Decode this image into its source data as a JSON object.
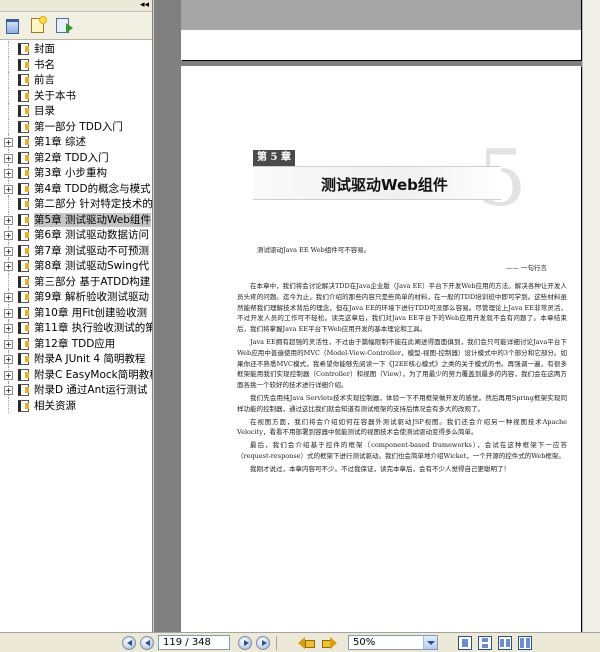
{
  "sidebar": {
    "collapse_glyph": "◂◂",
    "toolbar": [
      {
        "name": "trash-icon"
      },
      {
        "name": "new-bookmark-icon"
      },
      {
        "name": "bookmark-prop-icon"
      }
    ],
    "bookmarks": [
      {
        "label": "封面",
        "expander": "",
        "current": false
      },
      {
        "label": "书名",
        "expander": "",
        "current": false
      },
      {
        "label": "前言",
        "expander": "",
        "current": false
      },
      {
        "label": "关于本书",
        "expander": "",
        "current": false
      },
      {
        "label": "目录",
        "expander": "",
        "current": false
      },
      {
        "label": "第一部分 TDD入门",
        "expander": "",
        "current": false
      },
      {
        "label": "第1章 综述",
        "expander": "+",
        "current": false
      },
      {
        "label": "第2章 TDD入门",
        "expander": "+",
        "current": false
      },
      {
        "label": "第3章 小步重构",
        "expander": "+",
        "current": false
      },
      {
        "label": "第4章 TDD的概念与模式",
        "expander": "+",
        "current": false
      },
      {
        "label": "第二部分 针对特定技术的",
        "expander": "",
        "current": false
      },
      {
        "label": "第5章 测试驱动Web组件",
        "expander": "+",
        "current": true
      },
      {
        "label": "第6章 测试驱动数据访问",
        "expander": "+",
        "current": false
      },
      {
        "label": "第7章 测试驱动不可预测",
        "expander": "+",
        "current": false
      },
      {
        "label": "第8章 测试驱动Swing代",
        "expander": "+",
        "current": false
      },
      {
        "label": "第三部分 基于ATDD构建",
        "expander": "",
        "current": false
      },
      {
        "label": "第9章 解析验收测试驱动",
        "expander": "+",
        "current": false
      },
      {
        "label": "第10章 用Fit创建验收测",
        "expander": "+",
        "current": false
      },
      {
        "label": "第11章 执行验收测试的策",
        "expander": "+",
        "current": false
      },
      {
        "label": "第12章 TDD应用",
        "expander": "+",
        "current": false
      },
      {
        "label": "附录A JUnit 4 简明教程",
        "expander": "+",
        "current": false
      },
      {
        "label": "附录C EasyMock简明教程",
        "expander": "+",
        "current": false
      },
      {
        "label": "附录D 通过Ant运行测试",
        "expander": "+",
        "current": false
      },
      {
        "label": "相关资源",
        "expander": "",
        "current": false
      }
    ]
  },
  "document": {
    "chapter_badge": "第 5 章",
    "chapter_title": "测试驱动Web组件",
    "chapter_number": "5",
    "epigraph": "测试驱动Java EE Web组件可不容易。",
    "epigraph_author": "—— 一句行言",
    "paragraphs": [
      "在本章中，我们将会讨论解决TDD在Java企业版（Java EE）平台下开发Web应用的方法。解决各种让开发人员头疼的问题。迄今为止，我们介绍的那些内容只是些简单的材料，在一般的TDD培训班中即可学到。这些材料虽然能帮我们理解技术背后的理念，但在Java EE的环境下进行TDD可没那么容易。尽管理论上Java EE非常灵活，不过开发人员的工作可不轻松。读完这章后，我们对Java EE平台下的Web应用开发就不会有问题了。本章结束后，我们将掌握Java EE平台下Web应用开发的基本理论和工具。",
      "Java EE拥有超强的灵活性，不过由于篇幅限制不能在此阐述得面面俱到，我们会只可能详细讨论Java平台下Web应用中普遍使用的MVC（Model-View-Controller，模型-视图-控制器）设计模式中的3个部分和它部分。如果你还不熟悉MVC模式，我希望你能够先阅读一下《J2EE核心模式》之类的关于模式的书。再强调一遍，有很多框架能用我们实现控制器（Controller）和视图（View），为了用最少的努力覆盖到最多的内容，我们会在这两方面各挑一个较好的技术进行详细介绍。",
      "我们先会用纯Java Servlets技术实现控制器，体验一下不用框架做开发的感觉。然后再用Spring框架实现同样功能的控制器，通过这比我们就会知道有测试框架的支持后情况会有多大的改观了。",
      "在视图方面，我们将会介绍如何在容器外测试驱动JSP视图。我们还会介绍另一种视图技术Apache Velocity，看看不用部署到容器中就能测试的视图技术会使测试驱动变得多么简单。",
      "最后，我们会介绍基于控件的框架（component-based frameworks），会试在这种框架下一应答（request-response）式的框架下进行测试驱动。我们也会简单地介绍Wicket，一个开源的控件式的Web框架。",
      "我刚才说过，本章内容可不少。不过我保证，读完本章后，会有不少人觉得自己更聪明了！"
    ]
  },
  "bottom_bar": {
    "page_indicator": "119 / 348",
    "zoom_value": "50%"
  }
}
